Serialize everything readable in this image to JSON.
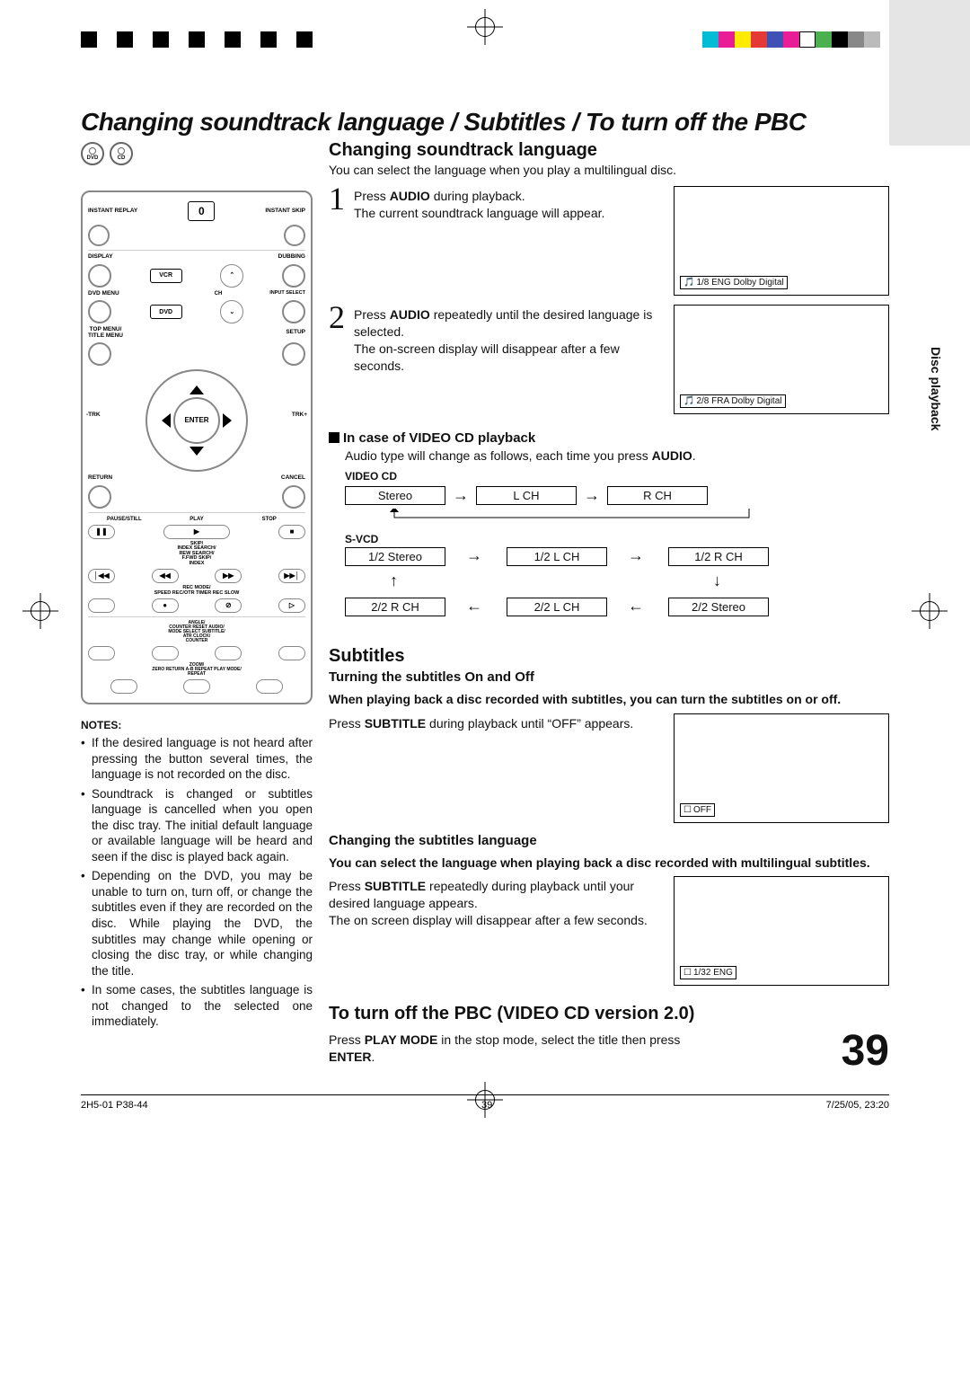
{
  "title": "Changing soundtrack language / Subtitles / To turn off the PBC",
  "icons": {
    "dvd": "DVD",
    "cd": "CD"
  },
  "remote": {
    "instantReplay": "INSTANT REPLAY",
    "instantSkip": "INSTANT SKIP",
    "zero": "0",
    "display": "DISPLAY",
    "dubbing": "DUBBING",
    "vcr": "VCR",
    "ch": "CH",
    "dvdmenu": "DVD MENU",
    "inputSelect": "INPUT SELECT",
    "dvd": "DVD",
    "topmenu": "TOP MENU/\nTITLE MENU",
    "setup": "SETUP",
    "trkMinus": "-TRK",
    "enter": "ENTER",
    "trkPlus": "TRK+",
    "return": "RETURN",
    "cancel": "CANCEL",
    "pauseStill": "PAUSE/STILL",
    "play": "PLAY",
    "stop": "STOP",
    "pauseSym": "❚❚",
    "playSym": "▶",
    "stopSym": "■",
    "row1labels": "SKIP/\nINDEX   SEARCH/\nREW   SEARCH/\nF.FWD   SKIP/\nINDEX",
    "skipb": "│◀◀",
    "rew": "◀◀",
    "ffwd": "▶▶",
    "skipf": "▶▶│",
    "row2labels": "REC MODE/\nSPEED   REC/OTR  TIMER REC   SLOW",
    "rec": "●",
    "timer": "⊘",
    "slow": "▷",
    "row3labels": "ANGLE/\nCOUNTER RESET  AUDIO/\nMODE SELECT  SUBTITLE/\nATR  CLOCK/\nCOUNTER",
    "row4labels": "ZOOM/\nZERO RETURN  A-B REPEAT  PLAY MODE/\nREPEAT"
  },
  "notes": {
    "title": "NOTES:",
    "items": [
      "If the desired language is not heard after pressing the button several times, the language is not recorded on the disc.",
      "Soundtrack is changed or subtitles language is cancelled when you open the disc tray. The initial default language or available language will be heard and seen if the disc is played back again.",
      "Depending on the DVD, you may be unable to turn on, turn off, or change the subtitles even if they are recorded on the disc. While playing the DVD, the subtitles may change while opening or closing the disc tray, or while changing the title.",
      "In some cases, the subtitles language is not changed to the selected one immediately."
    ]
  },
  "right": {
    "h1": "Changing soundtrack language",
    "h1intro": "You can select the language when you play a multilingual disc.",
    "step1": {
      "num": "1",
      "t1": "Press ",
      "b1": "AUDIO",
      "t2": " during playback.\nThe current soundtrack language will appear.",
      "osd": "1/8 ENG Dolby Digital"
    },
    "step2": {
      "num": "2",
      "t1": "Press ",
      "b1": "AUDIO",
      "t2": " repeatedly until the desired language is selected.\nThe on-screen display will disappear after a few seconds.",
      "osd": "2/8 FRA Dolby Digital"
    },
    "vcdTitle": "In case of VIDEO CD playback",
    "vcdLine": "Audio type will change as follows, each time you press ",
    "vcdBold": "AUDIO",
    "vcdLine2": ".",
    "videoCdLabel": "VIDEO CD",
    "videoCdFlow": [
      "Stereo",
      "L CH",
      "R CH"
    ],
    "svcdLabel": "S-VCD",
    "svcdTop": [
      "1/2 Stereo",
      "1/2 L CH",
      "1/2 R CH"
    ],
    "svcdBot": [
      "2/2 R CH",
      "2/2 L CH",
      "2/2 Stereo"
    ],
    "h2": "Subtitles",
    "turnTitle": "Turning the subtitles On and Off",
    "turnDesc": "When playing back a disc recorded with subtitles, you can turn the subtitles on or off.",
    "turnStep": {
      "t1": "Press ",
      "b1": "SUBTITLE",
      "t2": " during playback until “OFF” appears.",
      "osd": "OFF"
    },
    "changeTitle": "Changing the subtitles language",
    "changeDesc": "You can select the language when playing back a disc recorded with multilingual subtitles.",
    "changeStep": {
      "t1": "Press ",
      "b1": "SUBTITLE",
      "t2": " repeatedly during playback until your desired language appears.\nThe on screen display will disappear after a few seconds.",
      "osd": "1/32 ENG"
    },
    "h3": "To turn off the PBC (VIDEO CD version 2.0)",
    "pbcStep": {
      "t1": "Press ",
      "b1": "PLAY MODE",
      "t2": " in the stop mode, select the title then press ",
      "b2": "ENTER",
      "t3": "."
    },
    "pageNum": "39"
  },
  "sideLabel": "Disc playback",
  "footer": {
    "file": "2H5-01 P38-44",
    "page": "39",
    "date": "7/25/05, 23:20"
  }
}
